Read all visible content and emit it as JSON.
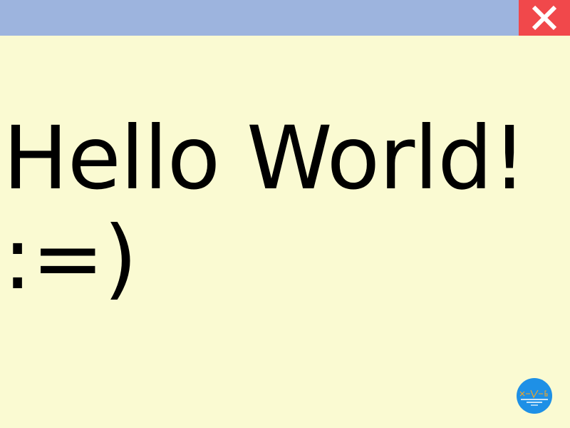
{
  "window": {
    "titlebar_color": "#9db4de",
    "background_color": "#fafad2",
    "close_button_color": "#f1484b",
    "close_icon": "close-icon"
  },
  "content": {
    "line1": "Hello World!",
    "line2": ":=)"
  },
  "logo": {
    "icon": "xyg-logo-icon",
    "color": "#1e90e6",
    "accent": "#f5a623"
  }
}
